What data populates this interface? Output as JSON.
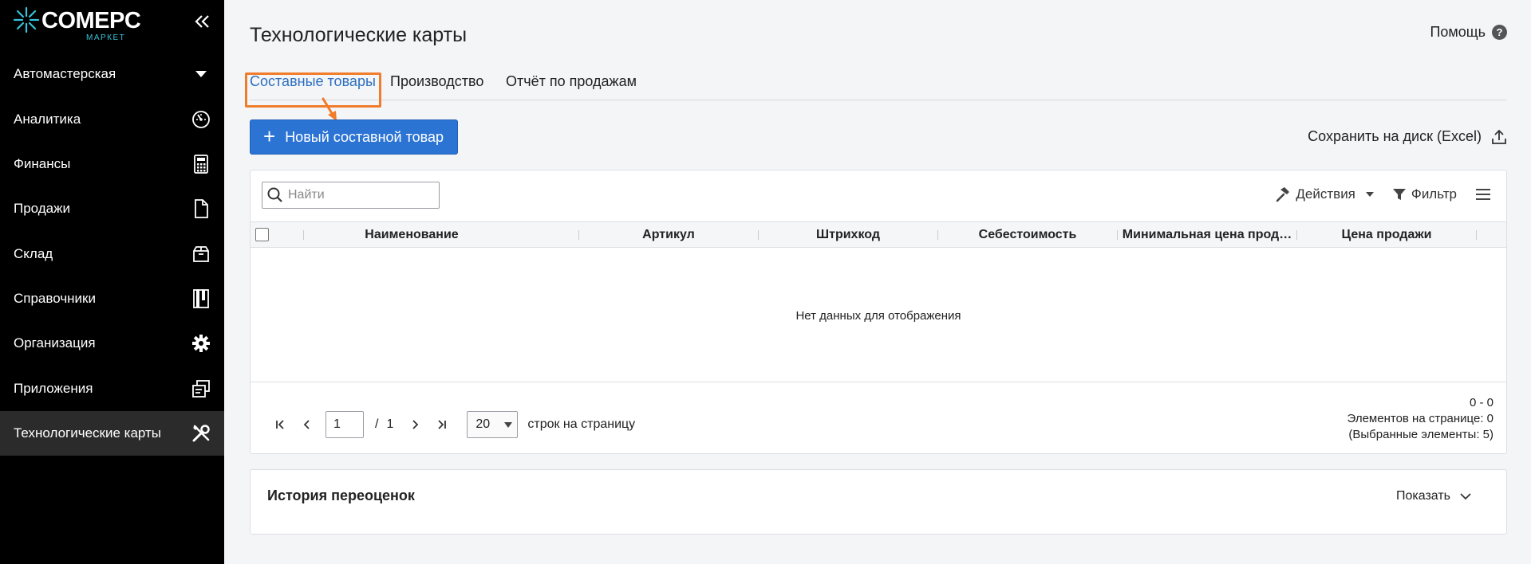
{
  "sidebar": {
    "logo_text": "COMEPC",
    "logo_sub": "МАРКЕТ",
    "store": "Автомастерская",
    "items": [
      {
        "label": "Аналитика",
        "icon": "gauge-icon"
      },
      {
        "label": "Финансы",
        "icon": "calculator-icon"
      },
      {
        "label": "Продажи",
        "icon": "document-icon"
      },
      {
        "label": "Склад",
        "icon": "box-icon"
      },
      {
        "label": "Справочники",
        "icon": "book-icon"
      },
      {
        "label": "Организация",
        "icon": "gear-icon"
      },
      {
        "label": "Приложения",
        "icon": "windows-icon"
      },
      {
        "label": "Технологические карты",
        "icon": "tools-icon",
        "active": true
      }
    ]
  },
  "header": {
    "title": "Технологические карты",
    "help": "Помощь"
  },
  "tabs": [
    {
      "label": "Составные товары",
      "active": true
    },
    {
      "label": "Производство"
    },
    {
      "label": "Отчёт по продажам"
    }
  ],
  "toolbar": {
    "new_button": "Новый составной товар",
    "export": "Сохранить на диск (Excel)"
  },
  "grid": {
    "search_placeholder": "Найти",
    "actions": "Действия",
    "filter": "Фильтр",
    "columns": [
      "Наименование",
      "Артикул",
      "Штрихкод",
      "Себестоимость",
      "Минимальная цена прод…",
      "Цена продажи"
    ],
    "empty": "Нет данных для отображения"
  },
  "pager": {
    "page": "1",
    "separator": "/",
    "total_pages": "1",
    "page_size": "20",
    "page_size_label": "строк на страницу",
    "range": "0 - 0",
    "per_page": "Элементов на странице: 0",
    "selected": "(Выбранные элементы: 5)"
  },
  "history": {
    "title": "История переоценок",
    "show": "Показать"
  },
  "colors": {
    "accent": "#2c74d4",
    "highlight": "#f07c2c",
    "sidebar_bg": "#000000",
    "active_item_bg": "#2b2b2b"
  }
}
